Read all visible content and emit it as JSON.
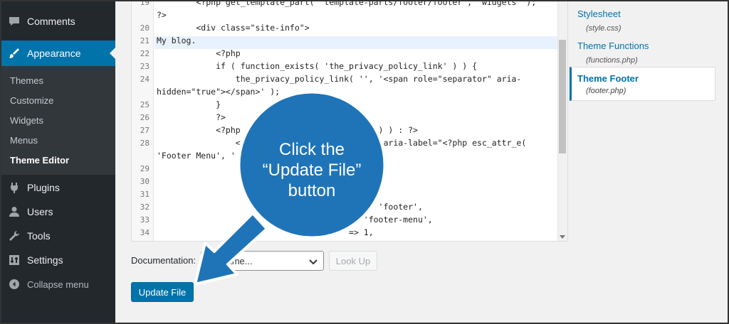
{
  "sidebar": {
    "comments": "Comments",
    "appearance": "Appearance",
    "submenu": [
      "Themes",
      "Customize",
      "Widgets",
      "Menus",
      "Theme Editor"
    ],
    "plugins": "Plugins",
    "users": "Users",
    "tools": "Tools",
    "settings": "Settings",
    "collapse": "Collapse menu"
  },
  "editor": {
    "lines": [
      {
        "n": "19",
        "text": "        <?php get_template_part( 'template-parts/footer/footer', 'widgets' );"
      },
      {
        "n": "",
        "text": "?>"
      },
      {
        "n": "20",
        "text": "        <div class=\"site-info\">"
      },
      {
        "n": "21",
        "text": "My blog."
      },
      {
        "n": "22",
        "text": "            <?php"
      },
      {
        "n": "23",
        "text": "            if ( function_exists( 'the_privacy_policy_link' ) ) {"
      },
      {
        "n": "24",
        "text": "                the_privacy_policy_link( '', '<span role=\"separator\" aria-"
      },
      {
        "n": "",
        "text": "hidden=\"true\"></span>' );"
      },
      {
        "n": "25",
        "text": "            }"
      },
      {
        "n": "26",
        "text": "            ?>"
      },
      {
        "n": "27",
        "text": "            <?php                          ' ) ) : ?>"
      },
      {
        "n": "28",
        "text": "                <                          n\" aria-label=\"<?php esc_attr_e("
      },
      {
        "n": "",
        "text": "'Footer Menu', '"
      },
      {
        "n": "29",
        "text": ""
      },
      {
        "n": "30",
        "text": ""
      },
      {
        "n": "31",
        "text": ""
      },
      {
        "n": "32",
        "text": "                                       n' => 'footer',"
      },
      {
        "n": "33",
        "text": "                                       => 'footer-menu',"
      },
      {
        "n": "34",
        "text": "                                       => 1,"
      }
    ]
  },
  "files": [
    {
      "name": "Stylesheet",
      "path": "(style.css)"
    },
    {
      "name": "Theme Functions",
      "path": "(functions.php)"
    },
    {
      "name": "Theme Footer",
      "path": "(footer.php)"
    }
  ],
  "documentation": {
    "label": "Documentation:",
    "select_value": "on Name...",
    "lookup": "Look Up"
  },
  "update_button": "Update File",
  "callout": {
    "lines": [
      "Click the",
      "“Update File”",
      "button"
    ]
  },
  "colors": {
    "accent": "#0073aa",
    "callout": "#1f74b8"
  }
}
